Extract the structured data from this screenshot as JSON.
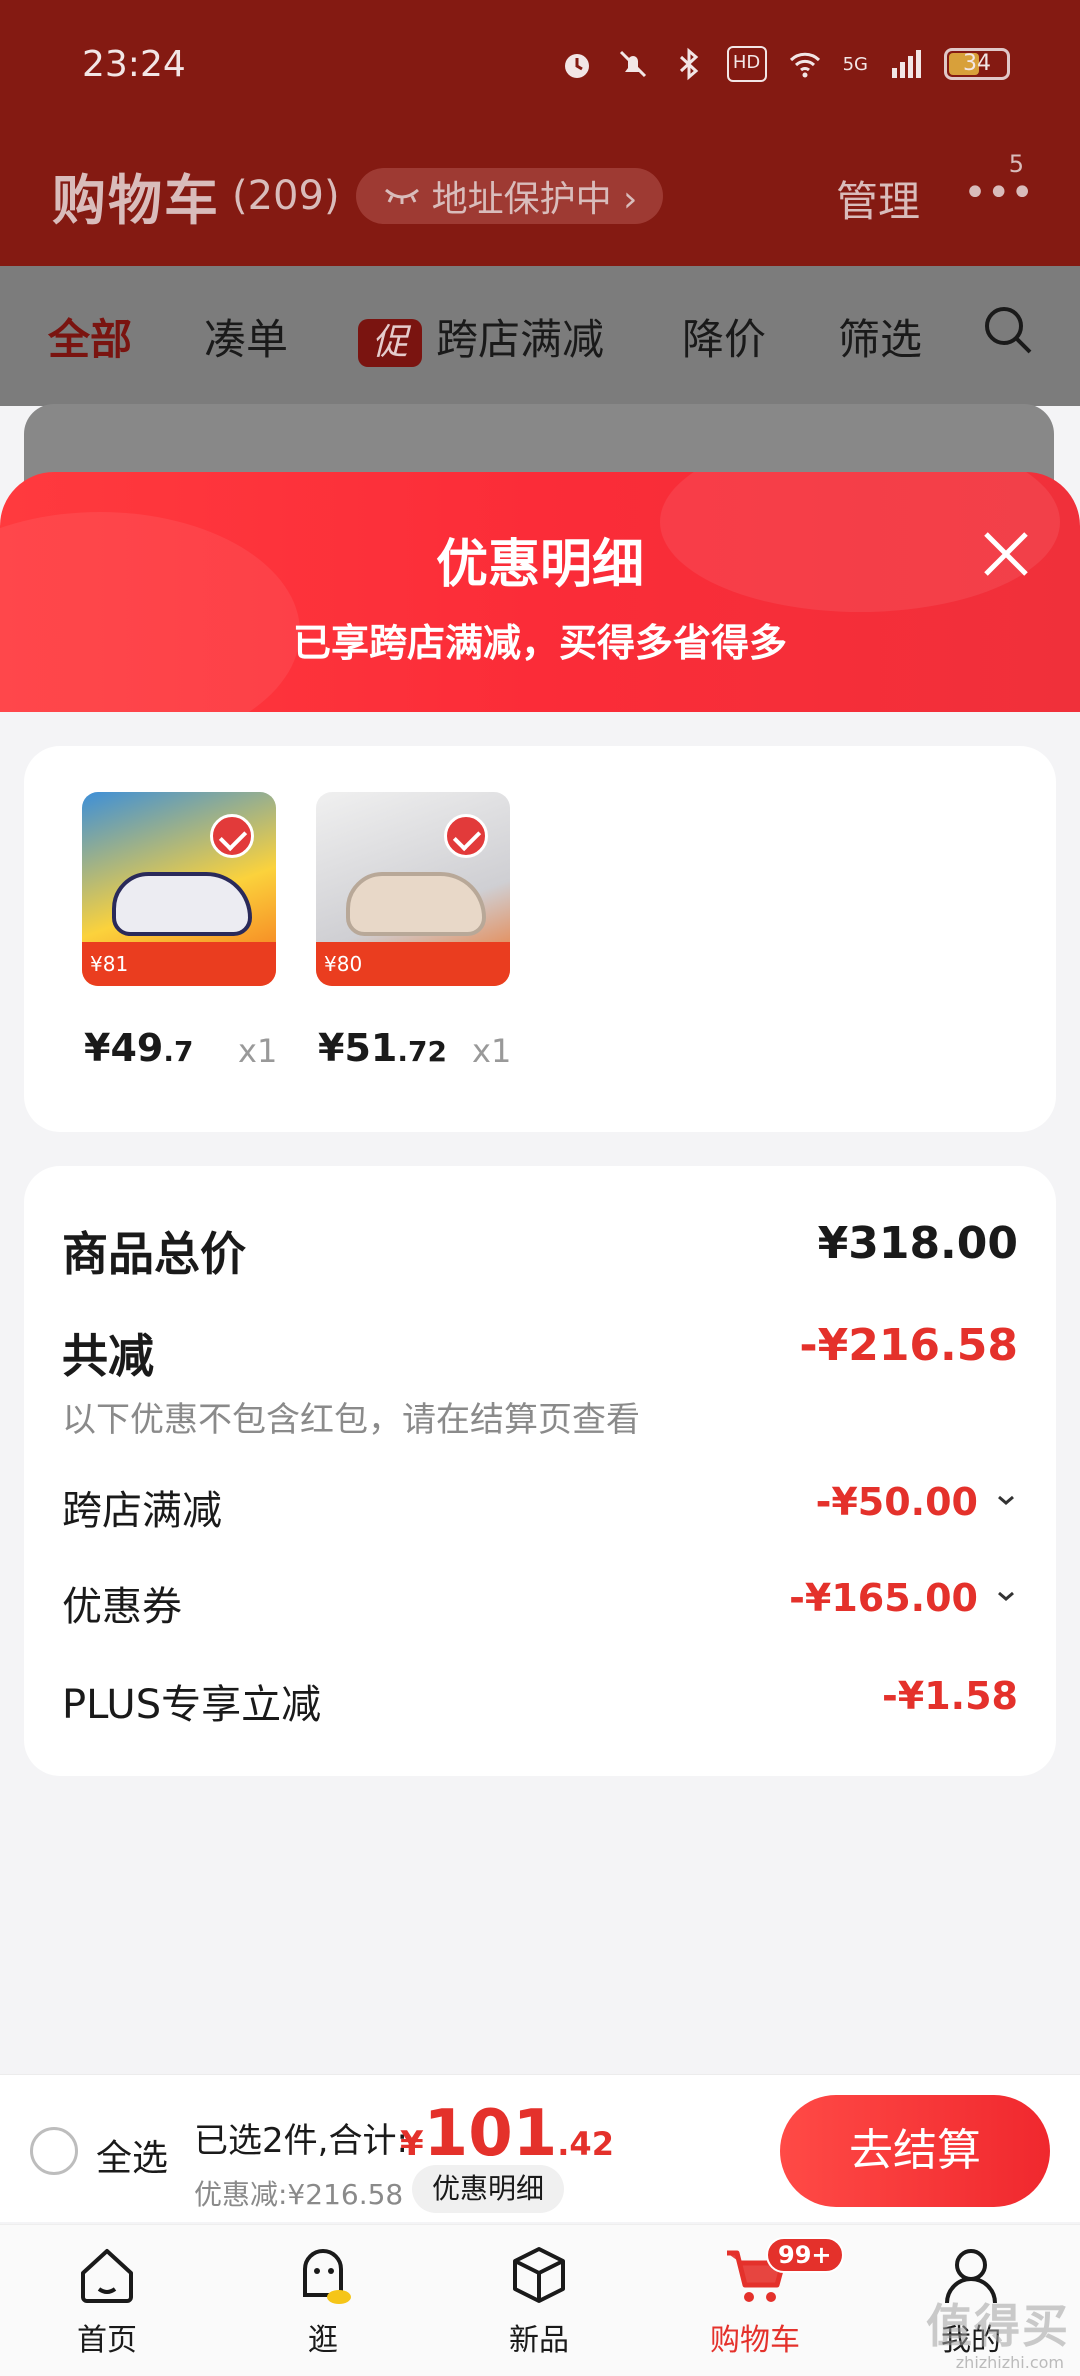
{
  "status_bar": {
    "time": "23:24",
    "battery": "34",
    "network": "5G",
    "hd": "HD"
  },
  "header": {
    "title": "购物车",
    "count": "(209)",
    "address_protect": "地址保护中 ›",
    "manage": "管理",
    "more_badge": "5"
  },
  "filters": {
    "all": "全部",
    "combine": "凑单",
    "promo_badge": "促",
    "cross_store": "跨店满减",
    "price_drop": "降价",
    "filter": "筛选"
  },
  "sheet": {
    "title": "优惠明细",
    "subtitle": "已享跨店满减，买得多省得多"
  },
  "products": [
    {
      "price_int": "¥49",
      "price_dec": ".7",
      "qty": "x1",
      "tag": "¥81"
    },
    {
      "price_int": "¥51",
      "price_dec": ".72",
      "qty": "x1",
      "tag": "¥80"
    }
  ],
  "summary": {
    "total_label": "商品总价",
    "total_value": "¥318.00",
    "reduce_label": "共减",
    "reduce_value": "-¥216.58",
    "reduce_note": "以下优惠不包含红包，请在结算页查看",
    "items": [
      {
        "label": "跨店满减",
        "value": "-¥50.00"
      },
      {
        "label": "优惠券",
        "value": "-¥165.00"
      },
      {
        "label": "PLUS专享立减",
        "value": "-¥1.58"
      }
    ]
  },
  "checkout": {
    "select_all": "全选",
    "selected_text": "已选2件,合计:",
    "currency": "¥",
    "total_int": "101",
    "total_dec": ".42",
    "discount_text": "优惠减:¥216.58",
    "detail_button": "优惠明细",
    "go_button": "去结算"
  },
  "tabs": [
    {
      "label": "首页"
    },
    {
      "label": "逛"
    },
    {
      "label": "新品"
    },
    {
      "label": "购物车",
      "badge": "99+"
    },
    {
      "label": "我的"
    }
  ],
  "watermark": {
    "text": "值得买",
    "sub": "zhizhizhi.com"
  }
}
